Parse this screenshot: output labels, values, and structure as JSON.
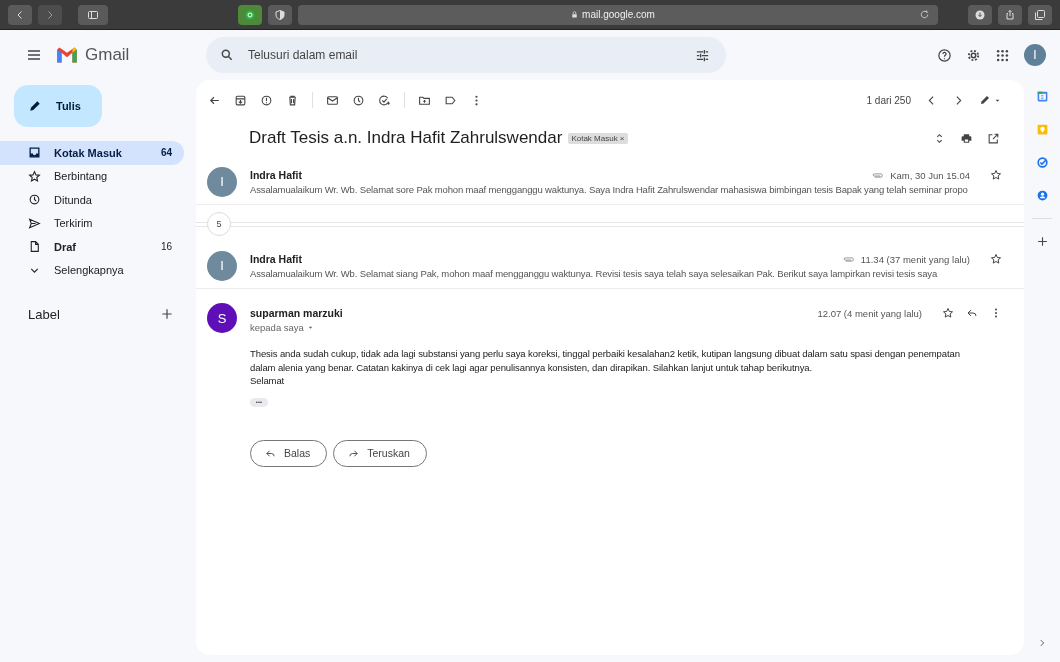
{
  "browser": {
    "url": "mail.google.com"
  },
  "header": {
    "app_name": "Gmail",
    "search": {
      "placeholder": "Telusuri dalam email"
    },
    "avatar": "I"
  },
  "compose": {
    "label": "Tulis"
  },
  "sidebar": {
    "items": [
      {
        "kind": "inbox",
        "label": "Kotak Masuk",
        "count": "64",
        "selected": true,
        "bold": true
      },
      {
        "kind": "star",
        "label": "Berbintang",
        "selected": false,
        "bold": false
      },
      {
        "kind": "clock",
        "label": "Ditunda",
        "selected": false,
        "bold": false
      },
      {
        "kind": "send",
        "label": "Terkirim",
        "selected": false,
        "bold": false
      },
      {
        "kind": "draft",
        "label": "Draf",
        "count": "16",
        "selected": false,
        "bold": true
      },
      {
        "kind": "chevron",
        "label": "Selengkapnya",
        "selected": false,
        "bold": false
      }
    ],
    "labels_heading": "Label"
  },
  "toolbar": {
    "pager": "1 dari 250"
  },
  "thread": {
    "subject": "Draft Tesis a.n. Indra Hafit Zahrulswendar",
    "tag": "Kotak Masuk",
    "tag_close": "×",
    "hidden_count": "5",
    "messages": [
      {
        "kind": "collapsed",
        "initial": "I",
        "color": "#6e8a9c",
        "sender": "Indra Hafit",
        "snippet": "Assalamualaikum Wr. Wb. Selamat sore Pak mohon maaf mengganggu waktunya. Saya Indra Hafit Zahrulswendar mahasiswa bimbingan tesis Bapak yang telah seminar propo",
        "attachment": true,
        "date": "Kam, 30 Jun 15.04",
        "starred": false
      },
      {
        "kind": "collapsed",
        "initial": "I",
        "color": "#6e8a9c",
        "sender": "Indra Hafit",
        "snippet": "Assalamualaikum Wr. Wb. Selamat siang Pak, mohon maaf mengganggu waktunya. Revisi tesis saya telah saya selesaikan Pak. Berikut saya lampirkan revisi tesis saya",
        "attachment": true,
        "date": "11.34 (37 menit yang lalu)",
        "starred": false
      },
      {
        "kind": "expanded",
        "initial": "S",
        "color": "#5f0fb8",
        "sender": "suparman marzuki",
        "recipient": "kepada saya",
        "date": "12.07 (4 menit yang lalu)",
        "starred": false,
        "body": [
          "Thesis anda sudah cukup, tidak ada lagi substansi yang perlu saya koreksi, tinggal perbaiki kesalahan2 ketik, kutipan langsung dibuat dalam satu spasi dengan penempatan",
          "dalam alenia yang benar. Catatan kakinya di cek lagi agar penulisannya konsisten, dan dirapikan. Silahkan lanjut untuk tahap berikutnya.",
          "Selamat"
        ],
        "ellipsis": "•••",
        "reply": "Balas",
        "forward": "Teruskan"
      }
    ]
  }
}
